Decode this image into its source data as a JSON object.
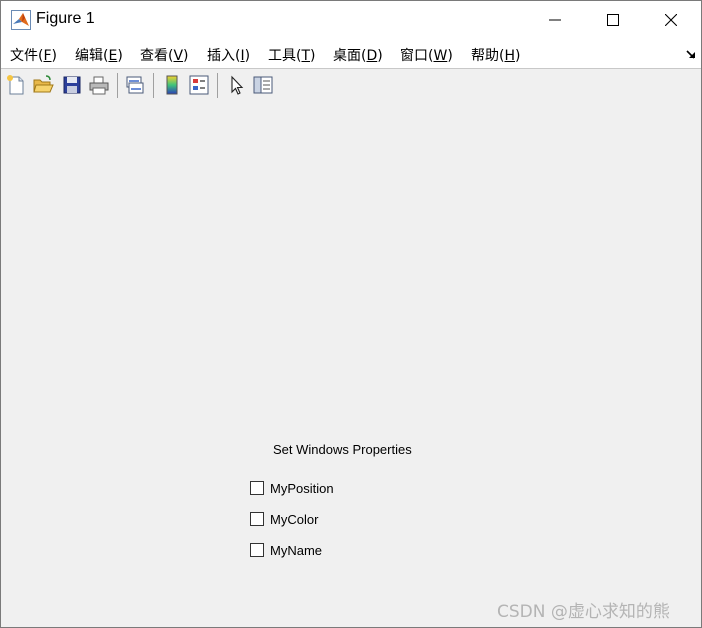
{
  "window": {
    "title": "Figure 1",
    "icons": {
      "app": "matlab-logo-icon",
      "minimize": "minimize-icon",
      "maximize": "maximize-icon",
      "close": "close-icon"
    }
  },
  "menubar": {
    "items": [
      {
        "text": "文件(",
        "accel": "F",
        "end": ")"
      },
      {
        "text": "编辑(",
        "accel": "E",
        "end": ")"
      },
      {
        "text": "查看(",
        "accel": "V",
        "end": ")"
      },
      {
        "text": "插入(",
        "accel": "I",
        "end": ")"
      },
      {
        "text": "工具(",
        "accel": "T",
        "end": ")"
      },
      {
        "text": "桌面(",
        "accel": "D",
        "end": ")"
      },
      {
        "text": "窗口(",
        "accel": "W",
        "end": ")"
      },
      {
        "text": "帮助(",
        "accel": "H",
        "end": ")"
      }
    ],
    "dock_icon": "dock-arrow-icon"
  },
  "toolbar": {
    "buttons": [
      "new-figure-icon",
      "open-file-icon",
      "save-icon",
      "print-icon",
      "link-plot-icon",
      "colorbar-icon",
      "legend-icon",
      "pointer-icon",
      "property-inspector-icon"
    ]
  },
  "panel": {
    "title": "Set Windows Properties",
    "checkboxes": [
      {
        "label": "MyPosition",
        "checked": false
      },
      {
        "label": "MyColor",
        "checked": false
      },
      {
        "label": "MyName",
        "checked": false
      }
    ]
  },
  "watermark": "CSDN @虚心求知的熊"
}
